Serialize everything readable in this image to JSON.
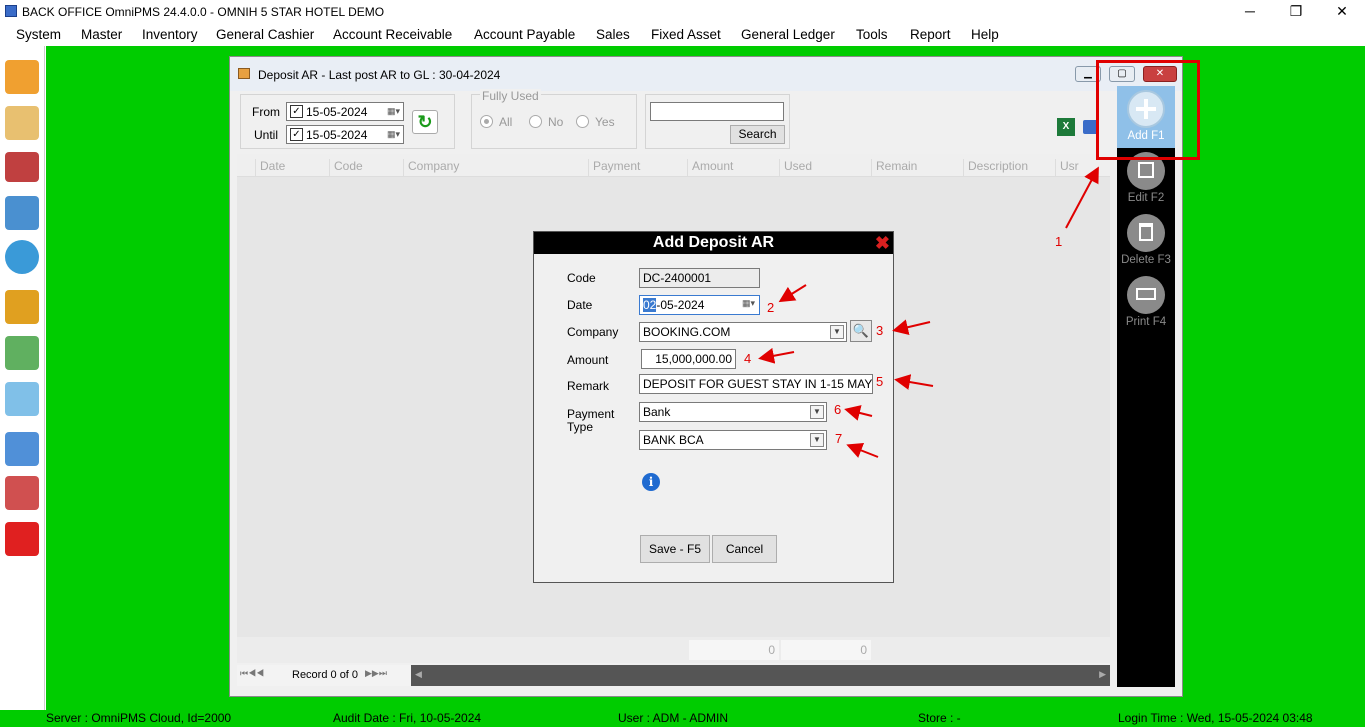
{
  "app": {
    "title": "BACK OFFICE OmniPMS 24.4.0.0 - OMNIH 5 STAR HOTEL DEMO"
  },
  "window_controls": {
    "minimize": "─",
    "restore": "❐",
    "close": "✕"
  },
  "menu": [
    "System",
    "Master",
    "Inventory",
    "General Cashier",
    "Account Receivable",
    "Account Payable",
    "Sales",
    "Fixed Asset",
    "General Ledger",
    "Tools",
    "Report",
    "Help"
  ],
  "child_window": {
    "title": "Deposit AR - Last post AR to GL : 30-04-2024"
  },
  "filter": {
    "from_label": "From",
    "from_value": "15-05-2024",
    "until_label": "Until",
    "until_value": "15-05-2024",
    "fully_used_label": "Fully Used",
    "options": [
      "All",
      "No",
      "Yes"
    ],
    "search_button": "Search"
  },
  "grid": {
    "columns": [
      "Date",
      "Code",
      "Company",
      "Payment",
      "Amount",
      "Used",
      "Remain",
      "Description",
      "Usr"
    ],
    "footer_amount": "0",
    "footer_used": "0"
  },
  "pager": {
    "record_text": "Record 0 of 0"
  },
  "side_buttons": {
    "add": "Add F1",
    "edit": "Edit F2",
    "delete": "Delete F3",
    "print": "Print F4"
  },
  "dialog": {
    "title": "Add Deposit AR",
    "code_label": "Code",
    "code_value": "DC-2400001",
    "date_label": "Date",
    "date_value_sel": "02",
    "date_value_rest": "-05-2024",
    "company_label": "Company",
    "company_value": "BOOKING.COM",
    "amount_label": "Amount",
    "amount_value": "15,000,000.00",
    "remark_label": "Remark",
    "remark_value": "DEPOSIT FOR GUEST STAY IN 1-15 MAY",
    "payment_type_label": "Payment Type",
    "payment_type_value": "Bank",
    "payment_sub_value": "BANK BCA",
    "save_button": "Save - F5",
    "cancel_button": "Cancel"
  },
  "annotations": [
    "1",
    "2",
    "3",
    "4",
    "5",
    "6",
    "7"
  ],
  "status": {
    "server": "Server : OmniPMS Cloud, Id=2000",
    "audit": "Audit Date : Fri, 10-05-2024",
    "user": "User : ADM - ADMIN",
    "store": "Store :  -",
    "login": "Login Time : Wed, 15-05-2024 03:48"
  },
  "colors": {
    "desktop": "#00cc00",
    "annotation": "#e00000",
    "dialog_title_bg": "#000000"
  }
}
